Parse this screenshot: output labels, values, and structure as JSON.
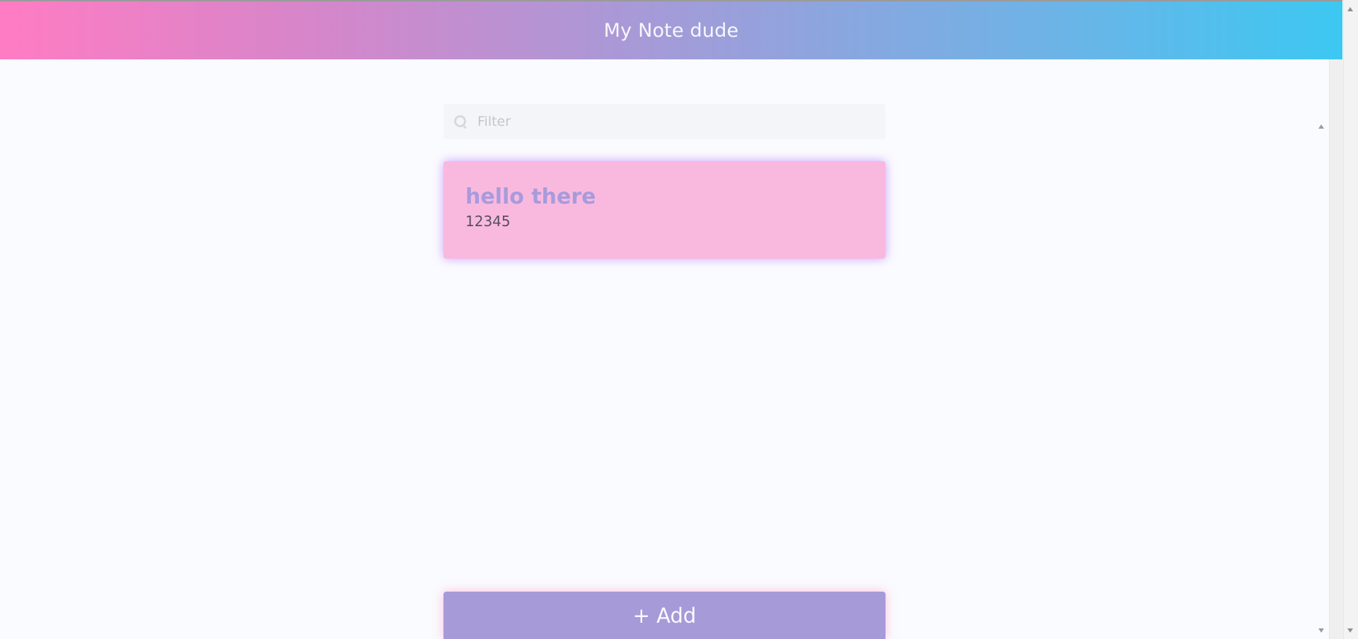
{
  "header": {
    "title": "My Note dude"
  },
  "search": {
    "placeholder": "Filter",
    "value": ""
  },
  "notes": [
    {
      "title": "hello there",
      "body": "12345"
    }
  ],
  "actions": {
    "add_label": "+ Add"
  },
  "colors": {
    "header_gradient_start": "#ff7cc3",
    "header_gradient_end": "#3cc8f2",
    "note_background": "#f9b9df",
    "note_title": "#a79bdb",
    "add_button": "#a79ad8"
  },
  "icons": {
    "search": "search-icon",
    "scroll_up": "chevron-up-icon",
    "scroll_down": "chevron-down-icon"
  }
}
